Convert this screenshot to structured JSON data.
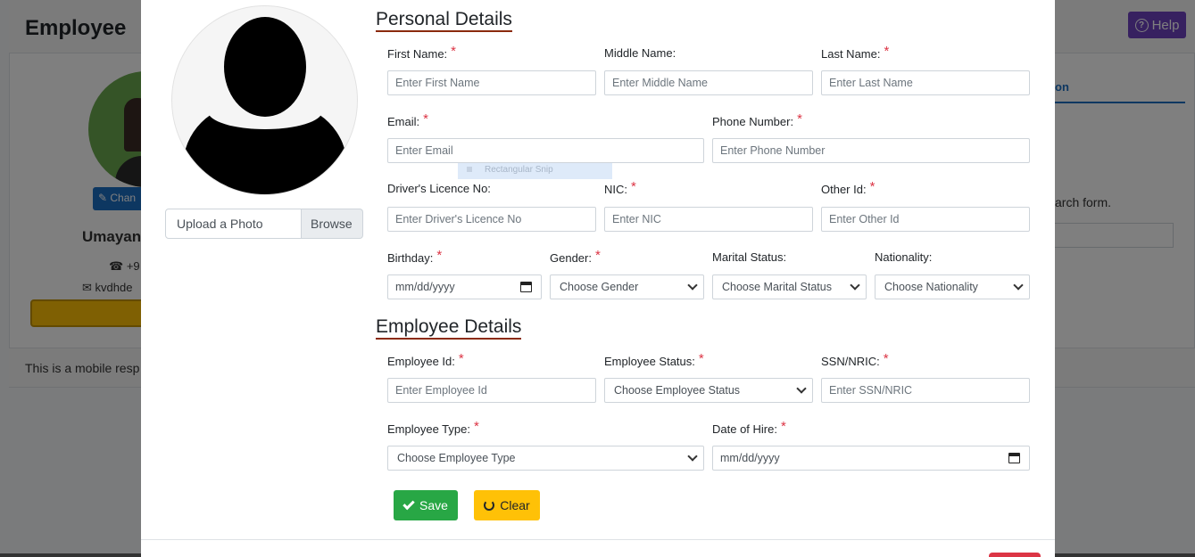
{
  "background": {
    "page_title": "Employee",
    "help_label": "Help",
    "change_label": "Chan",
    "employee_name": "Umayan",
    "phone_partial": "+9",
    "email_partial": "kvdhde",
    "tab_partial": "on",
    "search_text_partial": "arch form.",
    "footer_text": "This is a mobile resp"
  },
  "photo": {
    "upload_label": "Upload a Photo",
    "browse_label": "Browse"
  },
  "snip_overlay": "Rectangular Snip",
  "personal": {
    "title": "Personal Details",
    "first_name": {
      "label": "First Name:",
      "required": "*",
      "placeholder": "Enter First Name"
    },
    "middle_name": {
      "label": "Middle Name:",
      "placeholder": "Enter Middle Name"
    },
    "last_name": {
      "label": "Last Name:",
      "required": "*",
      "placeholder": "Enter Last Name"
    },
    "email": {
      "label": "Email:",
      "required": "*",
      "placeholder": "Enter Email"
    },
    "phone": {
      "label": "Phone Number:",
      "required": "*",
      "placeholder": "Enter Phone Number"
    },
    "licence": {
      "label": "Driver's Licence No:",
      "placeholder": "Enter Driver's Licence No"
    },
    "nic": {
      "label": "NIC:",
      "required": "*",
      "placeholder": "Enter NIC"
    },
    "other_id": {
      "label": "Other Id:",
      "required": "*",
      "placeholder": "Enter Other Id"
    },
    "birthday": {
      "label": "Birthday:",
      "required": "*",
      "value": "mm/dd/yyyy"
    },
    "gender": {
      "label": "Gender:",
      "required": "*",
      "selected": "Choose Gender"
    },
    "marital": {
      "label": "Marital Status:",
      "selected": "Choose Marital Status"
    },
    "nationality": {
      "label": "Nationality:",
      "selected": "Choose Nationality"
    }
  },
  "employee": {
    "title": "Employee Details",
    "employee_id": {
      "label": "Employee Id:",
      "required": "*",
      "placeholder": "Enter Employee Id"
    },
    "status": {
      "label": "Employee Status:",
      "required": "*",
      "selected": "Choose Employee Status"
    },
    "ssn": {
      "label": "SSN/NRIC:",
      "required": "*",
      "placeholder": "Enter SSN/NRIC"
    },
    "type": {
      "label": "Employee Type:",
      "required": "*",
      "selected": "Choose Employee Type"
    },
    "hire_date": {
      "label": "Date of Hire:",
      "required": "*",
      "value": "mm/dd/yyyy"
    }
  },
  "actions": {
    "save_label": "Save",
    "clear_label": "Clear"
  },
  "colors": {
    "save": "#28a745",
    "clear": "#ffc107",
    "required": "#dc3545",
    "section_underline": "#8b2a0d"
  }
}
